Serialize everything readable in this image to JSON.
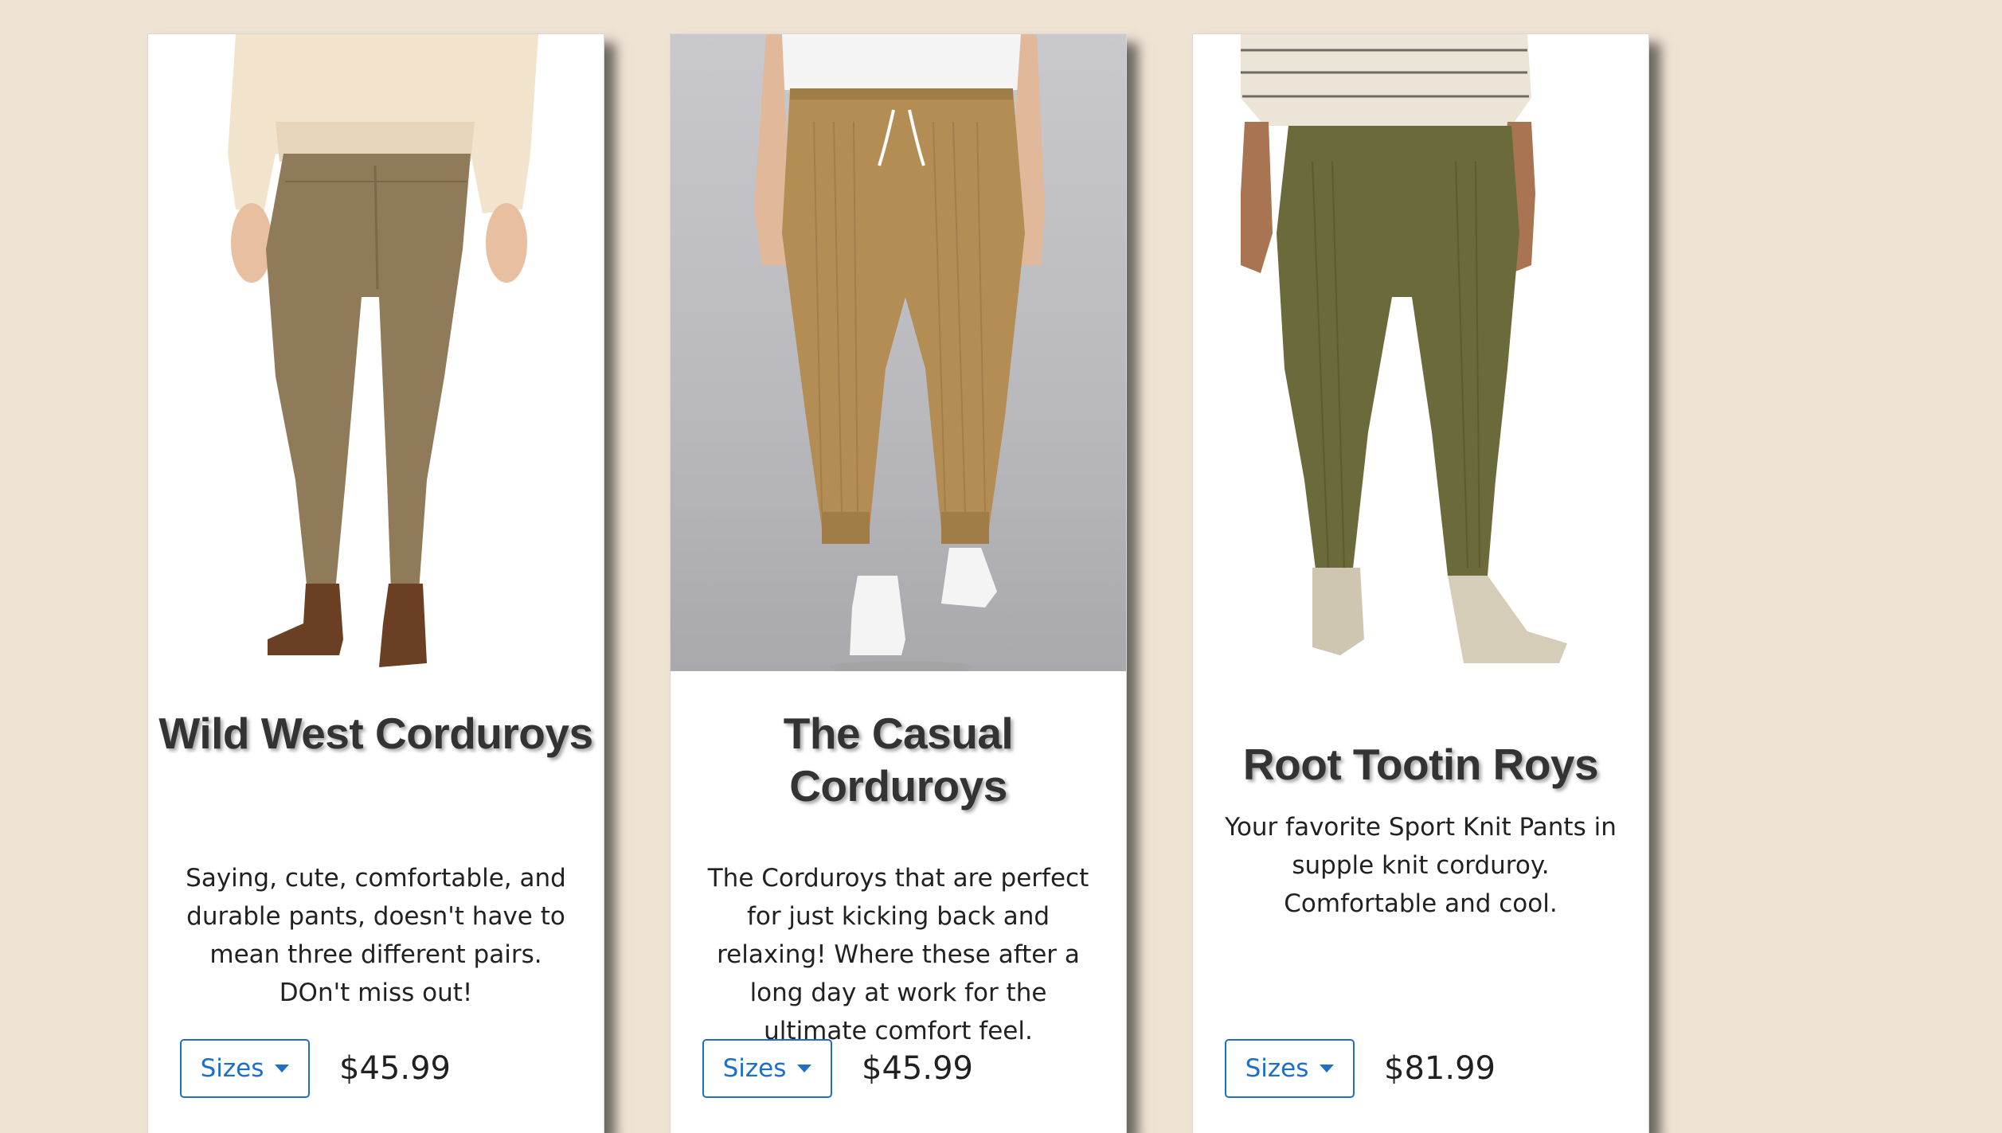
{
  "products": [
    {
      "title": "Wild West Corduroys",
      "description": "Saying, cute, comfortable, and durable pants, doesn't have to mean three different pairs. DOn't miss out!",
      "sizes_label": "Sizes",
      "price": "$45.99",
      "photo_icon": "product-photo-khaki-skinny-corduroys"
    },
    {
      "title": "The Casual Corduroys",
      "description": "The Corduroys that are perfect for just kicking back and relaxing! Where these after a long day at work for the ultimate comfort feel.",
      "sizes_label": "Sizes",
      "price": "$45.99",
      "photo_icon": "product-photo-tan-jogger-corduroys"
    },
    {
      "title": "Root Tootin Roys",
      "description": "Your favorite Sport Knit Pants in supple knit corduroy. Comfortable and cool.",
      "sizes_label": "Sizes",
      "price": "$81.99",
      "photo_icon": "product-photo-olive-straight-corduroys"
    }
  ],
  "colors": {
    "page_background": "#efe3d4",
    "card_background": "#ffffff",
    "button_blue": "#1f6fc4",
    "title_text": "#333333"
  }
}
